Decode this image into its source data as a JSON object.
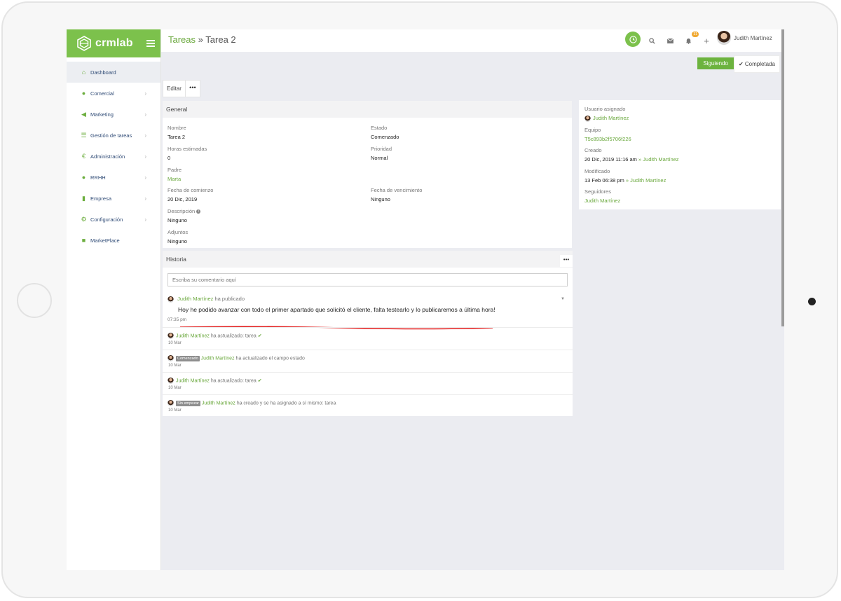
{
  "app": {
    "logo": "crmlab"
  },
  "breadcrumb": {
    "parent": "Tareas",
    "sep": "»",
    "current": "Tarea 2"
  },
  "topbar": {
    "notif_count": "31",
    "user_name": "Judith Martínez"
  },
  "sidebar": {
    "items": [
      {
        "label": "Dashboard",
        "icon": "home-icon",
        "glyph": "⌂"
      },
      {
        "label": "Comercial",
        "icon": "user-icon",
        "glyph": "●"
      },
      {
        "label": "Marketing",
        "icon": "megaphone-icon",
        "glyph": "◀"
      },
      {
        "label": "Gestión de tareas",
        "icon": "list-icon",
        "glyph": "☰"
      },
      {
        "label": "Administración",
        "icon": "euro-icon",
        "glyph": "€"
      },
      {
        "label": "RRHH",
        "icon": "users-icon",
        "glyph": "●"
      },
      {
        "label": "Empresa",
        "icon": "building-icon",
        "glyph": "▮"
      },
      {
        "label": "Configuración",
        "icon": "gear-icon",
        "glyph": "⚙"
      },
      {
        "label": "MarketPlace",
        "icon": "bag-icon",
        "glyph": "■"
      }
    ]
  },
  "actions": {
    "following": "Siguiendo",
    "completed": "✔ Completada",
    "edit": "Editar",
    "more": "•••"
  },
  "general": {
    "title": "General",
    "name_label": "Nombre",
    "name": "Tarea 2",
    "status_label": "Estado",
    "status": "Comenzado",
    "hours_label": "Horas estimadas",
    "hours": "0",
    "priority_label": "Prioridad",
    "priority": "Normal",
    "parent_label": "Padre",
    "parent": "Marta",
    "start_label": "Fecha de comienzo",
    "start": "20 Dic, 2019",
    "due_label": "Fecha de vencimiento",
    "due": "Ninguno",
    "desc_label": "Descripción",
    "desc": "Ninguno",
    "attach_label": "Adjuntos",
    "attach": "Ninguno"
  },
  "side": {
    "assigned_label": "Usuario asignado",
    "assigned": "Judith Martínez",
    "team_label": "Equipo",
    "team": "T5c893b2f5706f226",
    "created_label": "Creado",
    "created": "20 Dic, 2019 11:16 am",
    "created_by": "Judith Martínez",
    "modified_label": "Modificado",
    "modified": "13 Feb 06:38 pm",
    "modified_by": "Judith Martínez",
    "followers_label": "Seguidores",
    "followers": "Judith Martínez",
    "arrow": "»"
  },
  "history": {
    "title": "Historia",
    "placeholder": "Escriba su comentario aquí",
    "post": {
      "author": "Judith Martínez",
      "verb": "ha publicado",
      "message": "Hoy he podido avanzar con todo el primer apartado que solicitó el cliente, falta testearlo y lo publicaremos a última hora!",
      "time": "07:35 pm"
    },
    "activity": [
      {
        "tag": "",
        "author": "Judith Martínez",
        "text": "ha actualizado: tarea",
        "check": "✔",
        "date": "10 Mar"
      },
      {
        "tag": "Comenzado",
        "author": "Judith Martínez",
        "text": "ha actualizado el campo estado",
        "check": "",
        "date": "10 Mar"
      },
      {
        "tag": "",
        "author": "Judith Martínez",
        "text": "ha actualizado: tarea",
        "check": "✔",
        "date": "10 Mar"
      },
      {
        "tag": "Sin empezar",
        "author": "Judith Martínez",
        "text": "ha creado y se ha asignado a sí mismo: tarea",
        "check": "",
        "date": "10 Mar"
      }
    ]
  },
  "colors": {
    "brand": "#7cc14c",
    "link": "#6aa83d",
    "annotation": "#e21b1b"
  }
}
